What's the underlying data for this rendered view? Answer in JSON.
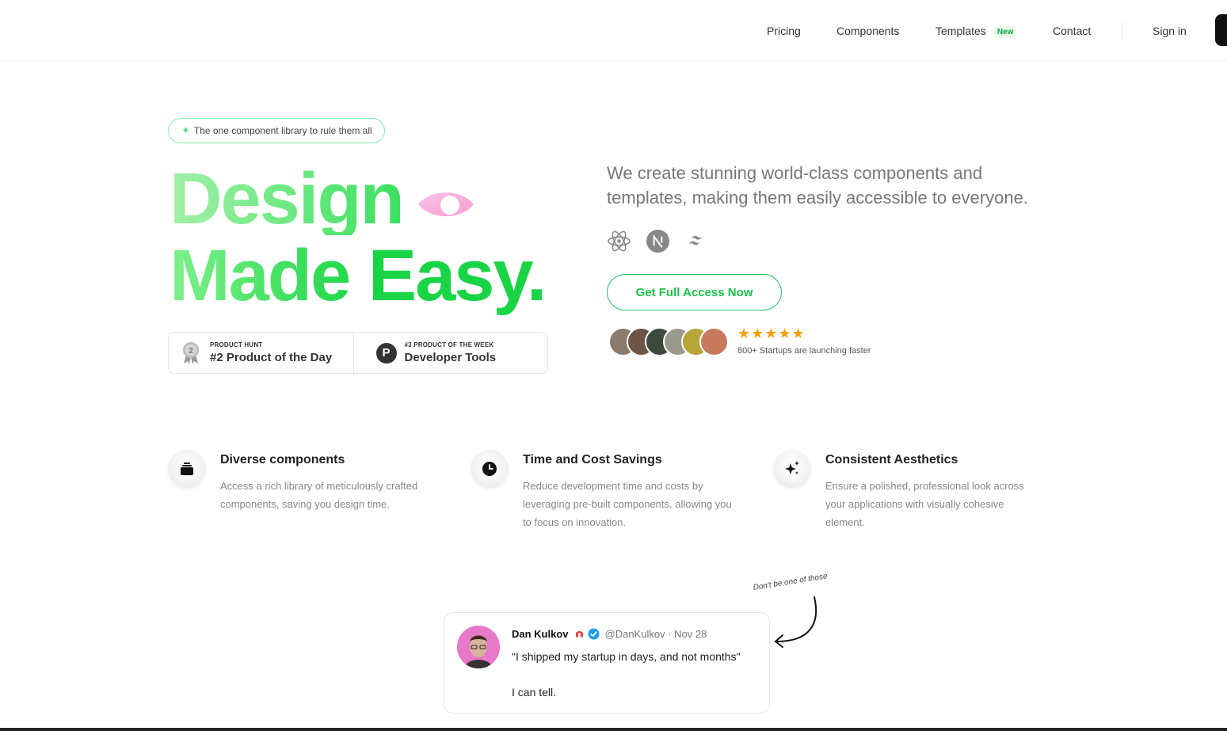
{
  "nav": {
    "links": [
      "Pricing",
      "Components",
      "Templates",
      "Contact"
    ],
    "templates_badge": "New",
    "sign_in": "Sign in"
  },
  "hero": {
    "pill": "The one component library to rule them all",
    "headline_line1": "Design",
    "headline_made": "Made",
    "headline_easy": "Easy.",
    "tagline": "We create stunning world-class components and templates, making them easily accessible to everyone.",
    "tech_icons": [
      "react-icon",
      "nextjs-icon",
      "tailwind-icon"
    ],
    "cta": "Get Full Access Now",
    "stars": "★★★★★",
    "social_proof": "800+ Startups are launching faster",
    "awards": [
      {
        "small": "PRODUCT HUNT",
        "big": "#2 Product of the Day",
        "medal_number": "2"
      },
      {
        "small": "#3 PRODUCT OF THE WEEK",
        "big": "Developer Tools",
        "logo_letter": "P"
      }
    ]
  },
  "features": [
    {
      "icon": "stack-icon",
      "title": "Diverse components",
      "desc": "Access a rich library of meticulously crafted components, saving you design time."
    },
    {
      "icon": "clock-icon",
      "title": "Time and Cost Savings",
      "desc": "Reduce development time and costs by leveraging pre-built components, allowing you to focus on innovation."
    },
    {
      "icon": "sparkles-icon",
      "title": "Consistent Aesthetics",
      "desc": "Ensure a polished, professional look across your applications with visually cohesive element."
    }
  ],
  "tweet": {
    "annotation": "Don't be one of those",
    "name": "Dan Kulkov",
    "handle": "@DanKulkov · Nov 28",
    "text1": "\"I shipped my startup in days, and not months\"",
    "text2": "I can tell."
  },
  "colors": {
    "accent_green": "#19d445",
    "star_orange": "#f59e0b"
  }
}
